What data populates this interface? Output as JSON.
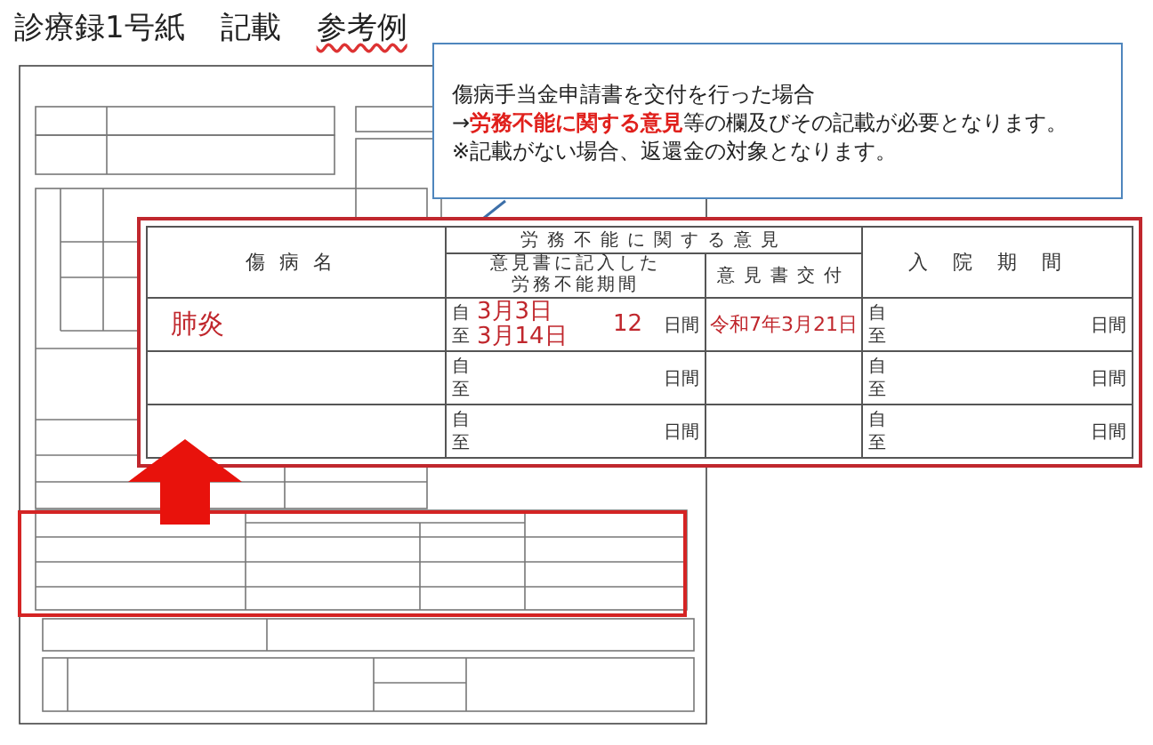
{
  "title_parts": [
    {
      "text": "診療録1号紙",
      "spellcheck_flagged": false
    },
    {
      "text": "記載",
      "spellcheck_flagged": false
    },
    {
      "text": "参考例",
      "spellcheck_flagged": true
    }
  ],
  "callout": {
    "lines": [
      "傷病手当金申請書を交付を行った場合",
      "→**労務不能に関する意見**等の欄及びその記載が必要となります。",
      "※記載がない場合、返還金の対象となります。"
    ]
  },
  "enlarged_table": {
    "header": {
      "disease_name": "傷病名",
      "opinion_group": "労務不能に関する意見",
      "period_lines": [
        "意見書に記入した",
        "労務不能期間"
      ],
      "issued": "意見書交付",
      "hospitalization": "入院期間"
    },
    "rows": [
      {
        "disease": "肺炎",
        "period_from_label": "自",
        "period_to_label": "至",
        "period_from": "3月3日",
        "period_to": "3月14日",
        "days": "12",
        "days_unit": "日間",
        "issued": "令和7年3月21日",
        "hosp_from_label": "自",
        "hosp_to_label": "至",
        "hosp_days_unit": "日間"
      },
      {
        "period_from_label": "自",
        "period_to_label": "至",
        "days_unit": "日間",
        "hosp_from_label": "自",
        "hosp_to_label": "至",
        "hosp_days_unit": "日間"
      },
      {
        "period_from_label": "自",
        "period_to_label": "至",
        "days_unit": "日間",
        "hosp_from_label": "自",
        "hosp_to_label": "至",
        "hosp_days_unit": "日間"
      }
    ]
  }
}
